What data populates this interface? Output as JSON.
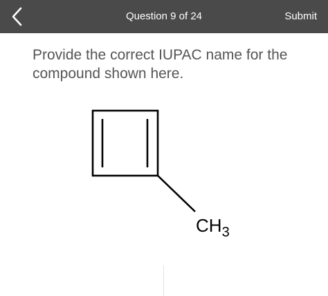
{
  "header": {
    "back_icon": "chevron-left-icon",
    "question_counter": "Question 9 of 24",
    "submit_label": "Submit",
    "background_color": "#4a4a4a"
  },
  "question": {
    "prompt": "Provide the correct IUPAC name for the compound shown here."
  },
  "structure": {
    "substituent_main": "CH",
    "substituent_subscript": "3"
  }
}
